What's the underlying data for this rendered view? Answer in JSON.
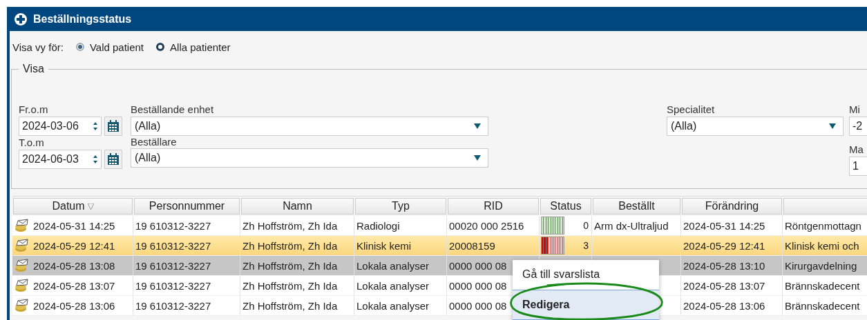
{
  "window": {
    "title": "Beställningsstatus"
  },
  "view_for": {
    "label": "Visa vy för:",
    "options": [
      {
        "label": "Vald patient",
        "selected": true
      },
      {
        "label": "Alla patienter",
        "selected": false
      }
    ]
  },
  "filter": {
    "legend": "Visa",
    "from": {
      "label": "Fr.o.m",
      "value": "2024-03-06"
    },
    "to": {
      "label": "T.o.m",
      "value": "2024-06-03"
    },
    "ordering_unit": {
      "label": "Beställande enhet",
      "value": "(Alla)"
    },
    "orderer": {
      "label": "Beställare",
      "value": "(Alla)"
    },
    "specialty": {
      "label": "Specialitet",
      "value": "(Alla)"
    },
    "min": {
      "label": "Mi",
      "value": "-2"
    },
    "max": {
      "label": "Ma",
      "value": "1"
    }
  },
  "table": {
    "columns": [
      "Datum",
      "Personnummer",
      "Namn",
      "Typ",
      "RID",
      "Status",
      "Beställt",
      "Förändring"
    ],
    "rows": [
      {
        "date": "2024-05-31 14:25",
        "personal_number": "19 610312-3227",
        "name": "Zh Hoffström, Zh Ida",
        "type": "Radiologi",
        "rid": "00020 000 2516",
        "status": {
          "kind": "ok",
          "level": 0,
          "count": "0"
        },
        "ordered": "Arm dx-Ultraljud",
        "changed": "2024-05-31 14:25",
        "column_9": "Röntgenmottagn",
        "selected": false,
        "hovered": false
      },
      {
        "date": "2024-05-29 12:41",
        "personal_number": "19 610312-3227",
        "name": "Zh Hoffström, Zh Ida",
        "type": "Klinisk kemi",
        "rid": "20008159",
        "status": {
          "kind": "alert",
          "level": 0.3,
          "count": "3"
        },
        "changed": "2024-05-29 12:41",
        "column_9": "Klinisk kemi och",
        "selected": true,
        "hovered": false
      },
      {
        "date": "2024-05-28 13:08",
        "personal_number": "19 610312-3227",
        "name": "Zh Hoffström, Zh Ida",
        "type": "Lokala analyser",
        "rid": "0000 000 08",
        "changed": "2024-05-28 13:10",
        "column_9": "Kirurgavdelning",
        "selected": false,
        "hovered": true
      },
      {
        "date": "2024-05-28 13:07",
        "personal_number": "19 610312-3227",
        "name": "Zh Hoffström, Zh Ida",
        "type": "Lokala analyser",
        "rid": "0000 000 08",
        "changed": "2024-05-28 13:07",
        "column_9": "Brännskadecent",
        "selected": false,
        "hovered": false
      },
      {
        "date": "2024-05-28 13:06",
        "personal_number": "19 610312-3227",
        "name": "Zh Hoffström, Zh Ida",
        "type": "Lokala analyser",
        "rid": "0000 000 08",
        "changed": "2024-05-28 13:06",
        "column_9": "Brännskadecent",
        "selected": false,
        "hovered": false
      }
    ]
  },
  "context_menu": {
    "items": [
      {
        "label": "Gå till svarslista",
        "selected": false
      },
      {
        "label": "Redigera",
        "selected": true
      }
    ]
  }
}
